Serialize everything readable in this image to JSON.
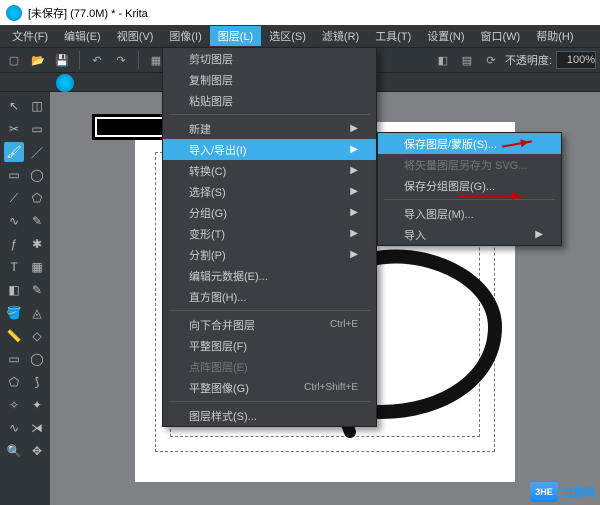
{
  "title": "[未保存] (77.0M) * - Krita",
  "menubar": [
    "文件(F)",
    "编辑(E)",
    "视图(V)",
    "图像(I)",
    "图层(L)",
    "选区(S)",
    "滤镜(R)",
    "工具(T)",
    "设置(N)",
    "窗口(W)",
    "帮助(H)"
  ],
  "menubar_open_index": 4,
  "opacity": {
    "label": "不透明度:",
    "value": "100%"
  },
  "menu1": [
    {
      "label": "剪切图层"
    },
    {
      "label": "复制图层"
    },
    {
      "label": "粘贴图层"
    },
    {
      "sep": true
    },
    {
      "label": "新建",
      "sub": true
    },
    {
      "label": "导入/导出(I)",
      "sub": true,
      "hl": true
    },
    {
      "label": "转换(C)",
      "sub": true
    },
    {
      "label": "选择(S)",
      "sub": true
    },
    {
      "label": "分组(G)",
      "sub": true
    },
    {
      "label": "变形(T)",
      "sub": true
    },
    {
      "label": "分割(P)",
      "sub": true
    },
    {
      "label": "编辑元数据(E)..."
    },
    {
      "label": "直方图(H)..."
    },
    {
      "sep": true
    },
    {
      "label": "向下合并图层",
      "shortcut": "Ctrl+E"
    },
    {
      "label": "平整图层(F)"
    },
    {
      "label": "点阵图层(E)",
      "disabled": true
    },
    {
      "label": "平整图像(G)",
      "shortcut": "Ctrl+Shift+E"
    },
    {
      "sep": true
    },
    {
      "label": "图层样式(S)..."
    }
  ],
  "menu2": [
    {
      "label": "保存图层/蒙版(S)...",
      "hl": true
    },
    {
      "label": "将矢量图层另存为 SVG...",
      "disabled": true
    },
    {
      "label": "保存分组图层(G)..."
    },
    {
      "sep": true
    },
    {
      "label": "导入图层(M)..."
    },
    {
      "label": "导入",
      "sub": true
    }
  ],
  "watermark": {
    "brand": "3HE",
    "site": "当游网"
  }
}
